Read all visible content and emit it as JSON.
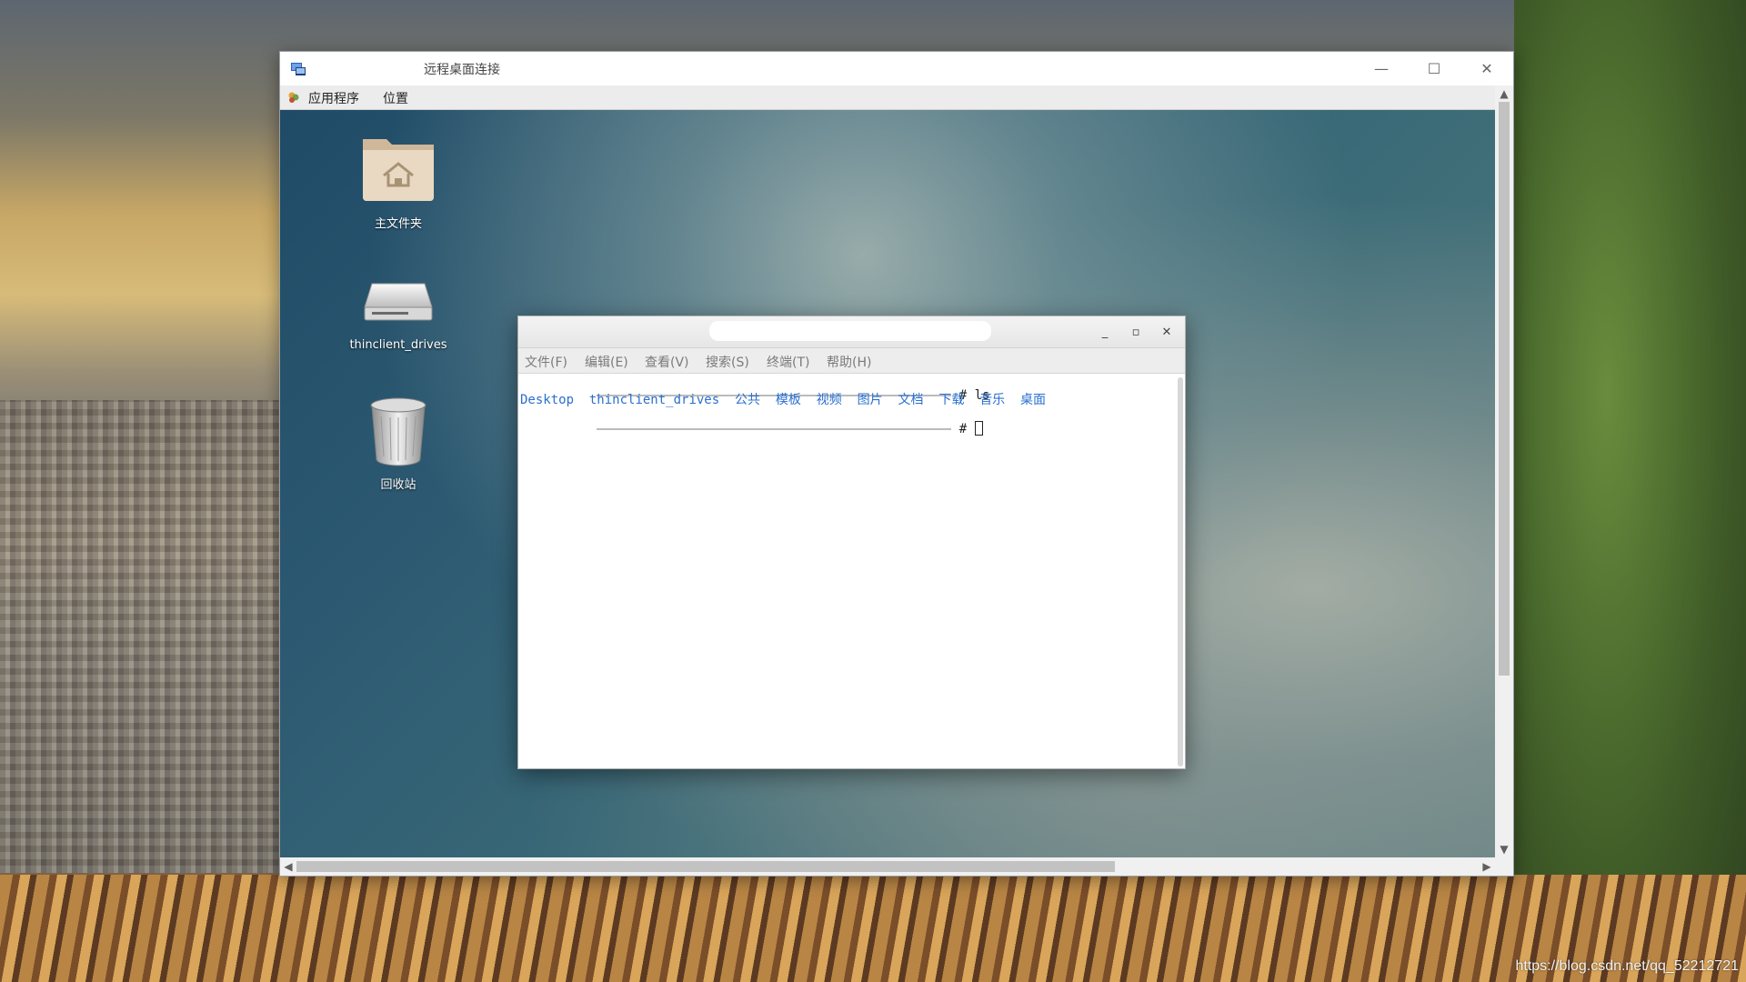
{
  "rdp_window": {
    "title": "远程桌面连接",
    "minimize_glyph": "—",
    "maximize_glyph": "☐",
    "close_glyph": "✕"
  },
  "remote_desktop": {
    "menubar": {
      "applications": "应用程序",
      "places": "位置"
    },
    "icons": [
      {
        "label": "主文件夹",
        "icon": "home-folder-icon"
      },
      {
        "label": "thinclient_drives",
        "icon": "drive-icon"
      },
      {
        "label": "回收站",
        "icon": "trash-icon"
      }
    ]
  },
  "terminal": {
    "minimize_glyph": "_",
    "maximize_glyph": "▫",
    "close_glyph": "✕",
    "menu": [
      "文件(F)",
      "编辑(E)",
      "查看(V)",
      "搜索(S)",
      "终端(T)",
      "帮助(H)"
    ],
    "command_line": "# ls",
    "ls_output": [
      "Desktop",
      "thinclient_drives",
      "公共",
      "模板",
      "视频",
      "图片",
      "文档",
      "下载",
      "音乐",
      "桌面"
    ],
    "prompt_line": "#"
  },
  "host": {
    "watermark": "https://blog.csdn.net/qq_52212721"
  },
  "colors": {
    "ls_directory": "#2a6fcf",
    "terminal_menu_text": "#7a7a7a"
  }
}
